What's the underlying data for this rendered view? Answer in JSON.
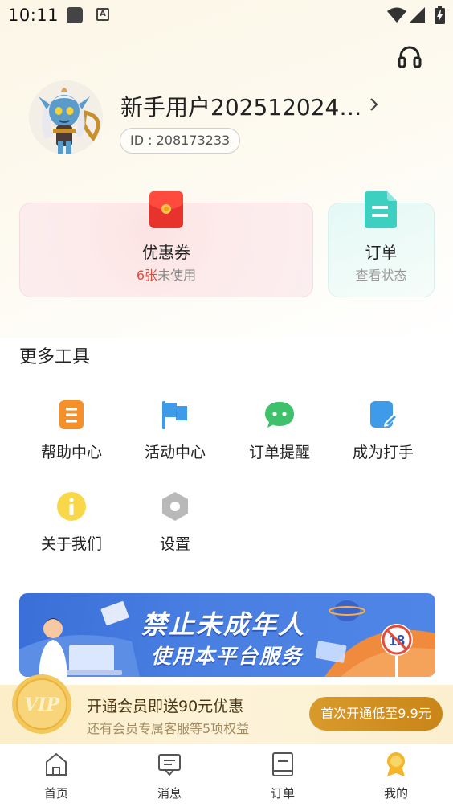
{
  "status_bar": {
    "time": "10:11"
  },
  "profile": {
    "username": "新手用户202512024…",
    "id_label": "ID : 208173233"
  },
  "cards": {
    "coupon": {
      "title": "优惠券",
      "count": "6张",
      "suffix": "未使用"
    },
    "order": {
      "title": "订单",
      "subtitle": "查看状态"
    }
  },
  "tools": {
    "heading": "更多工具",
    "items": [
      {
        "label": "帮助中心",
        "icon": "help-doc-icon",
        "color": "#f5902a"
      },
      {
        "label": "活动中心",
        "icon": "flag-icon",
        "color": "#3d9be9"
      },
      {
        "label": "订单提醒",
        "icon": "chat-bubble-icon",
        "color": "#3fc06b"
      },
      {
        "label": "成为打手",
        "icon": "edit-icon",
        "color": "#3d9be9"
      },
      {
        "label": "关于我们",
        "icon": "info-icon",
        "color": "#f8d84a"
      },
      {
        "label": "设置",
        "icon": "settings-hexagon-icon",
        "color": "#b9b9b9"
      }
    ]
  },
  "banner": {
    "line1": "禁止未成年人",
    "line2": "使用本平台服务",
    "badge": "18"
  },
  "vip": {
    "coin_text": "VIP",
    "title": "开通会员即送90元优惠",
    "subtitle": "还有会员专属客服等5项权益",
    "button": "首次开通低至9.9元"
  },
  "nav": {
    "items": [
      {
        "label": "首页",
        "icon": "home-icon"
      },
      {
        "label": "消息",
        "icon": "message-icon"
      },
      {
        "label": "订单",
        "icon": "order-icon"
      },
      {
        "label": "我的",
        "icon": "profile-icon"
      }
    ]
  }
}
